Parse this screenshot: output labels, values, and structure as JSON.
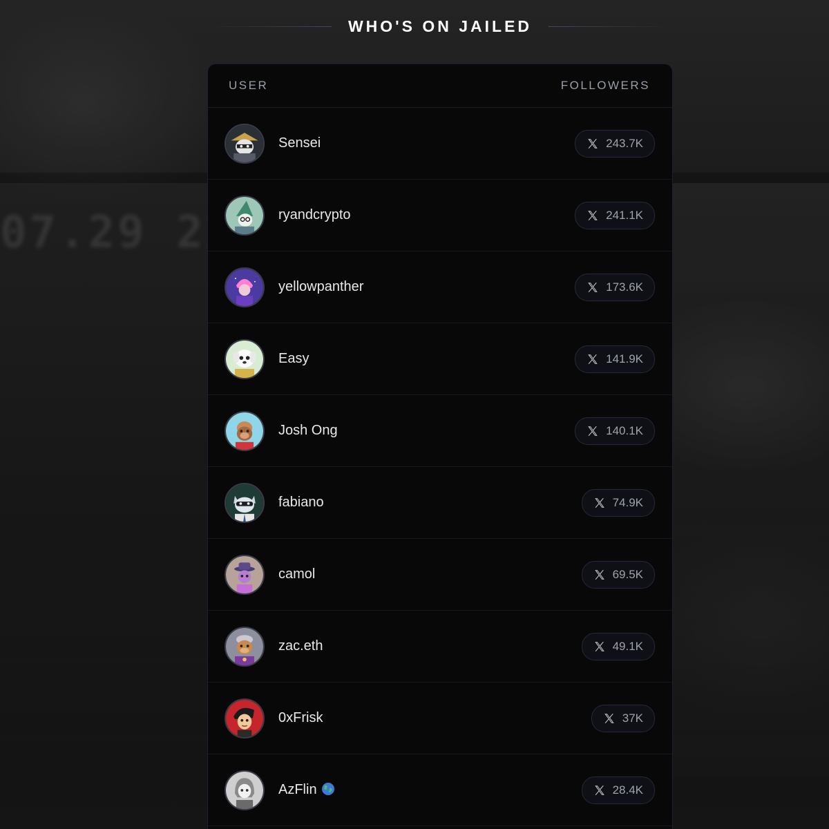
{
  "title": "WHO'S ON JAILED",
  "columns": {
    "user": "USER",
    "followers": "FOLLOWERS"
  },
  "rows": [
    {
      "name": "Sensei",
      "followers": "243.7K",
      "avatar_icon": "ninja-cat-avatar",
      "avatar_color": "#2b2f36"
    },
    {
      "name": "ryandcrypto",
      "followers": "241.1K",
      "avatar_icon": "wizard-avatar",
      "avatar_color": "#6a9e8c"
    },
    {
      "name": "yellowpanther",
      "followers": "173.6K",
      "avatar_icon": "pink-hair-avatar",
      "avatar_color": "#4b3aa0"
    },
    {
      "name": "Easy",
      "followers": "141.9K",
      "avatar_icon": "white-dog-avatar",
      "avatar_color": "#d8ecd2"
    },
    {
      "name": "Josh Ong",
      "followers": "140.1K",
      "avatar_icon": "ape-avatar",
      "avatar_color": "#8fd6e8"
    },
    {
      "name": "fabiano",
      "followers": "74.9K",
      "avatar_icon": "raccoon-avatar",
      "avatar_color": "#1f3b35"
    },
    {
      "name": "camol",
      "followers": "69.5K",
      "avatar_icon": "purple-hat-avatar",
      "avatar_color": "#b8a39a"
    },
    {
      "name": "zac.eth",
      "followers": "49.1K",
      "avatar_icon": "purple-monkey-avatar",
      "avatar_color": "#8d8f9e"
    },
    {
      "name": "0xFrisk",
      "followers": "37K",
      "avatar_icon": "cartoon-boy-avatar",
      "avatar_color": "#c4262c"
    },
    {
      "name": "AzFlin",
      "followers": "28.4K",
      "avatar_icon": "sketch-girl-avatar",
      "avatar_color": "#cfcfcf",
      "badge_icon": "globe-icon"
    }
  ]
}
